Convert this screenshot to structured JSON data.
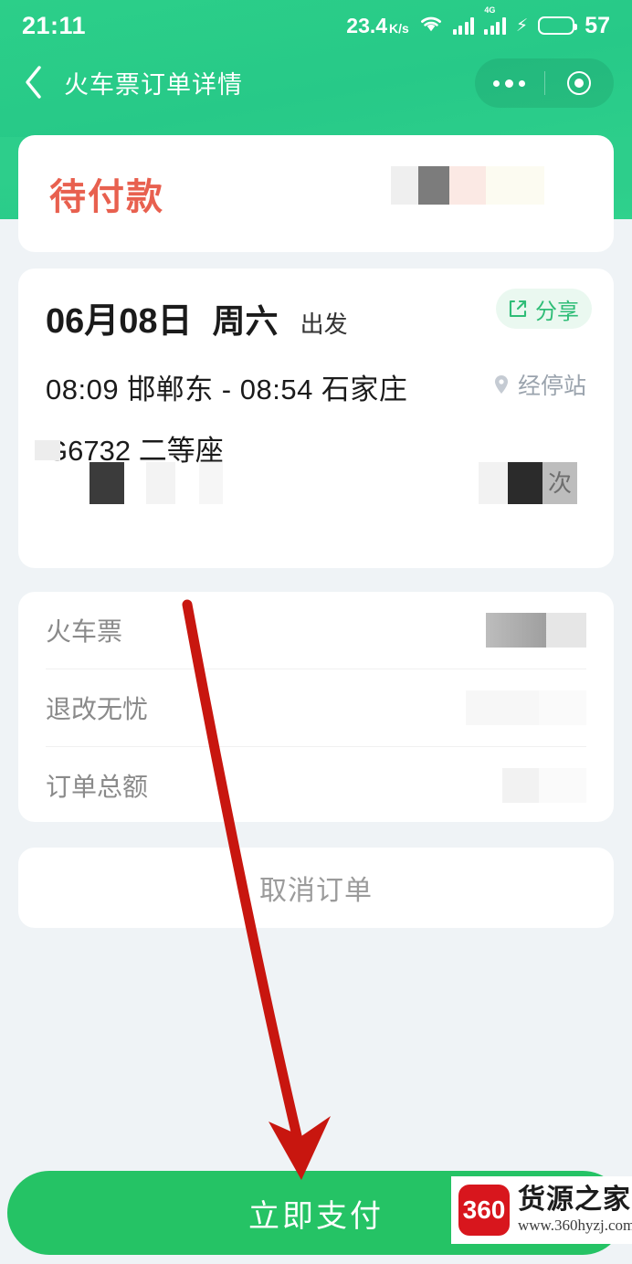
{
  "theme": {
    "brand_green": "#2dce8b",
    "pay_green": "#25c365",
    "status_red": "#e8604f",
    "page_bg": "#eff3f6",
    "muted": "#8a8a8a"
  },
  "status_bar": {
    "time": "21:11",
    "net_speed_value": "23.4",
    "net_speed_unit": "K/s",
    "network_tag": "4G",
    "battery_percent": "57"
  },
  "nav": {
    "title": "火车票订单详情",
    "back_icon": "chevron-left-icon",
    "menu_icon": "more-dots-icon",
    "capsule_icon": "target-circle-icon"
  },
  "order_status": {
    "label": "待付款"
  },
  "trip": {
    "date": "06月08日",
    "weekday": "周六",
    "depart_label": "出发",
    "share_label": "分享",
    "share_icon": "share-icon",
    "depart_time": "08:09",
    "depart_station": "邯郸东",
    "separator": "-",
    "arrive_time": "08:54",
    "arrive_station": "石家庄",
    "route_text": "08:09 邯郸东 - 08:54 石家庄",
    "stops_label": "经停站",
    "stops_icon": "location-pin-icon",
    "train_no": "G6732",
    "seat_class": "二等座",
    "train_line": "G6732  二等座",
    "passenger_redacted_fragment": "次"
  },
  "price": {
    "rows": [
      {
        "label": "火车票",
        "value": ""
      },
      {
        "label": "退改无忧",
        "value": ""
      },
      {
        "label": "订单总额",
        "value": ""
      }
    ]
  },
  "actions": {
    "cancel_label": "取消订单",
    "pay_label": "立即支付"
  },
  "annotation": {
    "arrow_color": "#c8160f",
    "arrow_from": "205,662",
    "arrow_to": "330,1292"
  },
  "watermark": {
    "logo_text": "360",
    "title": "货源之家",
    "url": "www.360hyzj.com"
  }
}
